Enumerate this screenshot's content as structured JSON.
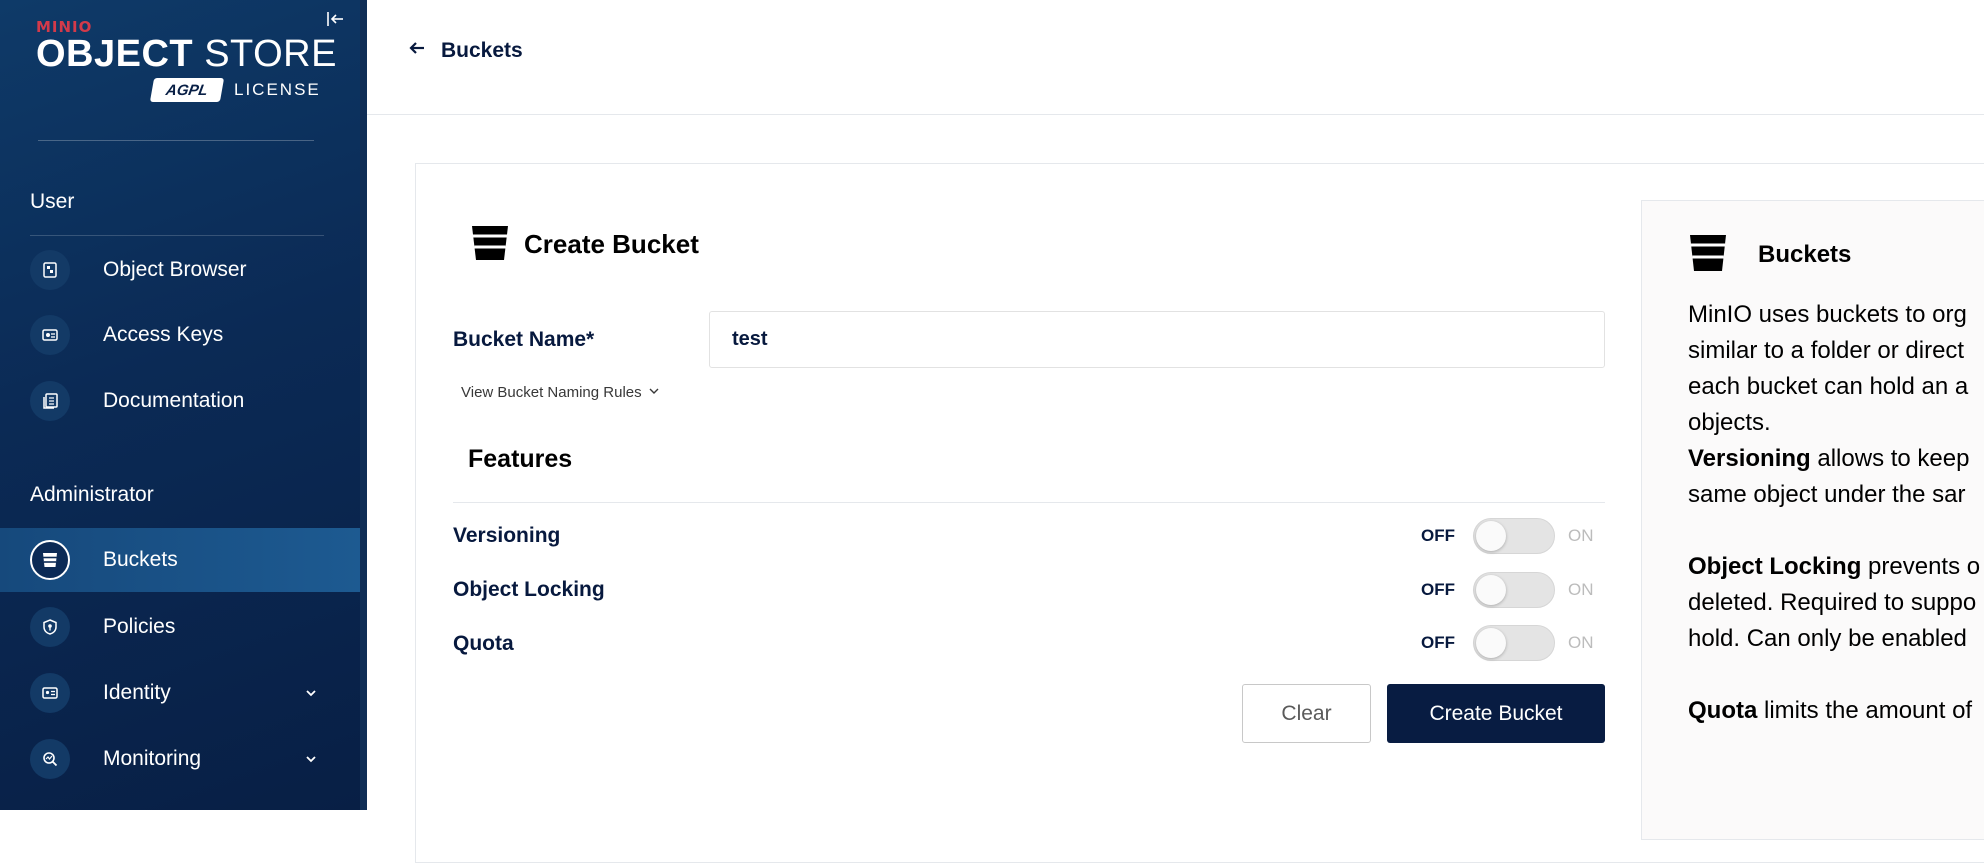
{
  "sidebar": {
    "logo": {
      "brand": "MINIO",
      "title_bold": "OBJECT",
      "title_rest": " STORE",
      "badge": "AGPL",
      "license": "LICENSE"
    },
    "sections": {
      "user": "User",
      "administrator": "Administrator"
    },
    "user_items": [
      {
        "label": "Object Browser",
        "icon": "object-browser-icon"
      },
      {
        "label": "Access Keys",
        "icon": "access-keys-icon"
      },
      {
        "label": "Documentation",
        "icon": "documentation-icon"
      }
    ],
    "admin_items": [
      {
        "label": "Buckets",
        "icon": "bucket-icon",
        "active": true
      },
      {
        "label": "Policies",
        "icon": "shield-icon"
      },
      {
        "label": "Identity",
        "icon": "identity-icon",
        "expandable": true
      },
      {
        "label": "Monitoring",
        "icon": "monitoring-icon",
        "expandable": true
      }
    ]
  },
  "header": {
    "back_label": "Buckets"
  },
  "form": {
    "title": "Create Bucket",
    "bucket_name_label": "Bucket Name*",
    "bucket_name_value": "test",
    "naming_rules_link": "View Bucket Naming Rules",
    "features_title": "Features",
    "features": [
      {
        "label": "Versioning",
        "off": "OFF",
        "on": "ON",
        "enabled": false
      },
      {
        "label": "Object Locking",
        "off": "OFF",
        "on": "ON",
        "enabled": false
      },
      {
        "label": "Quota",
        "off": "OFF",
        "on": "ON",
        "enabled": false
      }
    ],
    "clear_label": "Clear",
    "create_label": "Create Bucket"
  },
  "help": {
    "title": "Buckets",
    "intro_lines": [
      "MinIO uses buckets to org",
      "similar to a folder or direct",
      "each bucket can hold an a",
      "objects."
    ],
    "versioning_term": "Versioning",
    "versioning_lines": [
      " allows to keep",
      "same object under the sar"
    ],
    "locking_term": "Object Locking",
    "locking_lines": [
      " prevents o",
      "deleted. Required to suppo",
      "hold. Can only be enabled"
    ],
    "quota_term": "Quota",
    "quota_lines": [
      " limits the amount of"
    ]
  },
  "colors": {
    "sidebar_bg": "#0b2a55",
    "active_item": "#1d5a91",
    "primary_button": "#081c42",
    "brand_red": "#d33a4a"
  }
}
